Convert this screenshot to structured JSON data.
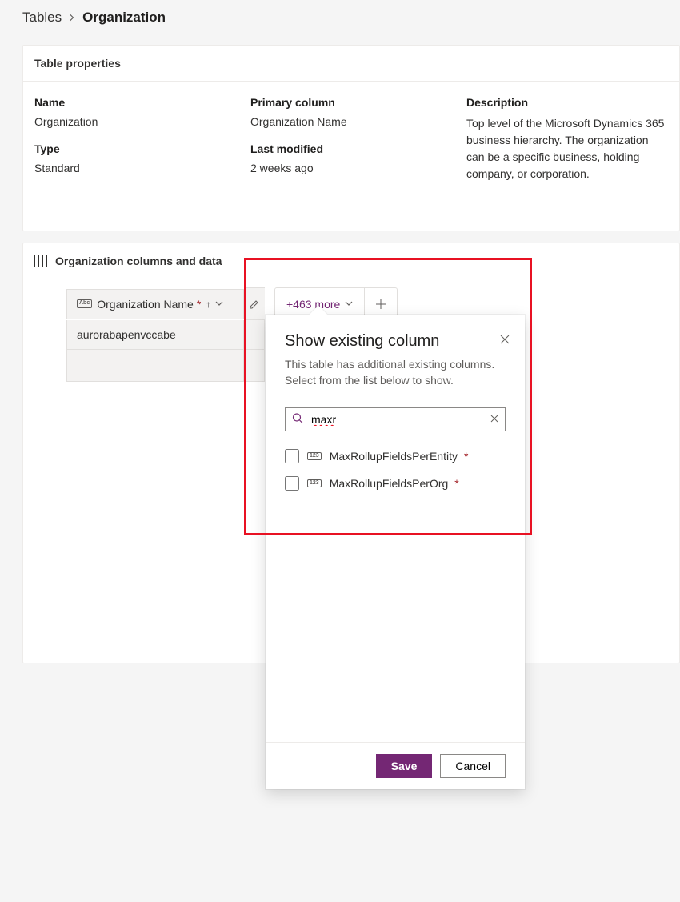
{
  "breadcrumb": {
    "parent": "Tables",
    "current": "Organization"
  },
  "properties": {
    "header": "Table properties",
    "name_label": "Name",
    "name_value": "Organization",
    "type_label": "Type",
    "type_value": "Standard",
    "primary_label": "Primary column",
    "primary_value": "Organization Name",
    "modified_label": "Last modified",
    "modified_value": "2 weeks ago",
    "description_label": "Description",
    "description_value": "Top level of the Microsoft Dynamics 365 business hierarchy. The organization can be a specific business, holding company, or corporation."
  },
  "columns_section": {
    "title": "Organization columns and data",
    "primary_column": "Organization Name",
    "more_label": "+463 more",
    "row1": "aurorabapenvccabe"
  },
  "flyout": {
    "title": "Show existing column",
    "subtitle": "This table has additional existing columns. Select from the list below to show.",
    "search_value": "maxr",
    "options": [
      {
        "label": "MaxRollupFieldsPerEntity"
      },
      {
        "label": "MaxRollupFieldsPerOrg"
      }
    ],
    "save": "Save",
    "cancel": "Cancel"
  }
}
